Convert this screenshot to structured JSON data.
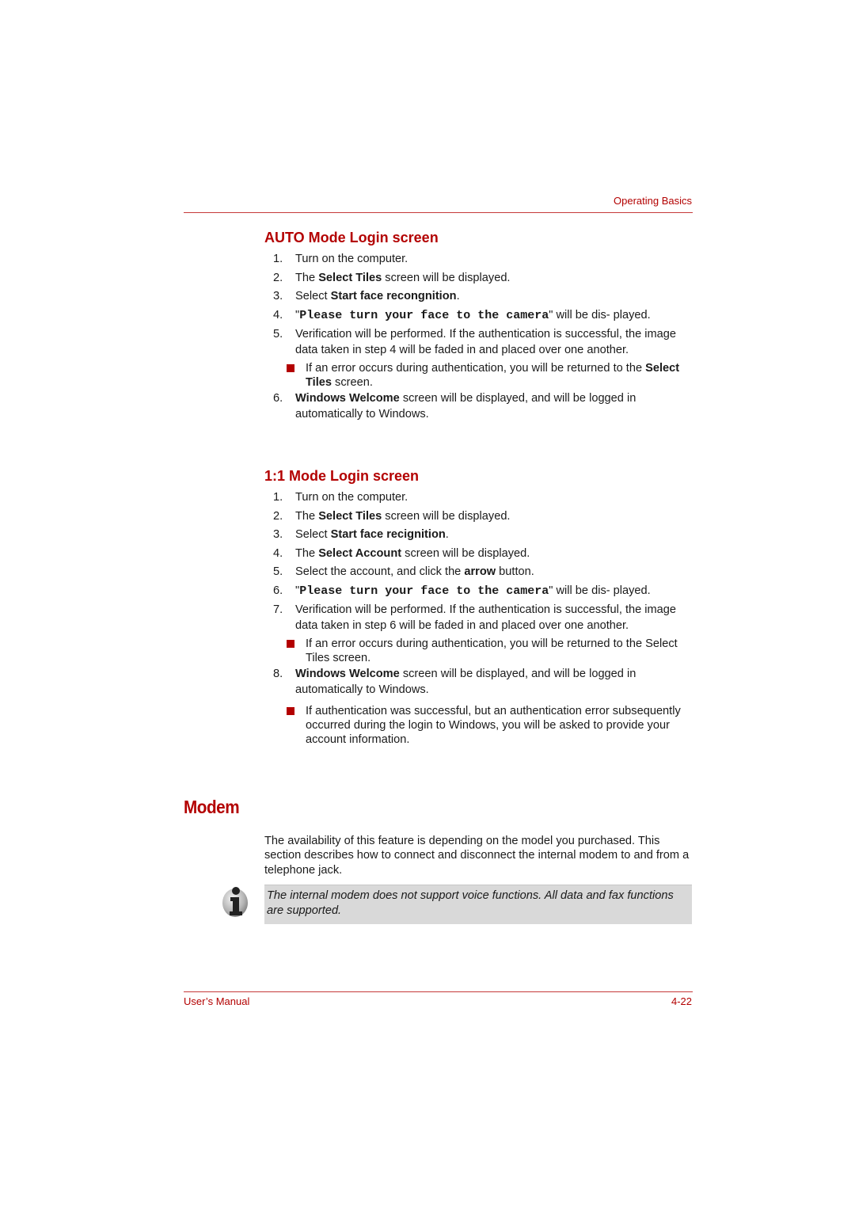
{
  "header": {
    "section_title": "Operating Basics"
  },
  "auto_mode": {
    "heading": "AUTO Mode Login screen",
    "steps": [
      {
        "num": "1.",
        "parts": [
          {
            "t": "Turn on the computer."
          }
        ]
      },
      {
        "num": "2.",
        "parts": [
          {
            "t": "The "
          },
          {
            "b": "Select Tiles"
          },
          {
            "t": " screen will be displayed."
          }
        ]
      },
      {
        "num": "3.",
        "parts": [
          {
            "t": "Select "
          },
          {
            "b": "Start face recongnition"
          },
          {
            "t": "."
          }
        ]
      },
      {
        "num": "4.",
        "parts": [
          {
            "t": "\""
          },
          {
            "m": "Please turn your face to the camera"
          },
          {
            "t": "\" will be dis- played."
          }
        ]
      },
      {
        "num": "5.",
        "parts": [
          {
            "t": "Verification will be performed. If the authentication is successful, the image data taken in step 4 will be faded in and placed over one another."
          }
        ]
      }
    ],
    "note": [
      {
        "t": "If an error occurs during authentication, you will be returned to the "
      },
      {
        "b": "Select Tiles"
      },
      {
        "t": " screen."
      }
    ],
    "steps_after": [
      {
        "num": "6.",
        "parts": [
          {
            "b": "Windows Welcome"
          },
          {
            "t": " screen will be displayed, and will be logged in automatically to Windows."
          }
        ]
      }
    ]
  },
  "one_to_one_mode": {
    "heading": "1:1 Mode Login screen",
    "steps": [
      {
        "num": "1.",
        "parts": [
          {
            "t": "Turn on the computer."
          }
        ]
      },
      {
        "num": "2.",
        "parts": [
          {
            "t": "The "
          },
          {
            "b": "Select Tiles"
          },
          {
            "t": " screen will be displayed."
          }
        ]
      },
      {
        "num": "3.",
        "parts": [
          {
            "t": "Select "
          },
          {
            "b": "Start face recignition"
          },
          {
            "t": "."
          }
        ]
      },
      {
        "num": "4.",
        "parts": [
          {
            "t": "The "
          },
          {
            "b": "Select Account"
          },
          {
            "t": " screen will be displayed."
          }
        ]
      },
      {
        "num": "5.",
        "parts": [
          {
            "t": "Select the account, and click the "
          },
          {
            "b": "arrow"
          },
          {
            "t": " button."
          }
        ]
      },
      {
        "num": "6.",
        "parts": [
          {
            "t": "\""
          },
          {
            "m": "Please turn your face to the camera"
          },
          {
            "t": "\" will be dis- played."
          }
        ]
      },
      {
        "num": "7.",
        "parts": [
          {
            "t": "Verification will be performed. If the authentication is successful, the image data taken in step 6 will be faded in and placed over one another."
          }
        ]
      }
    ],
    "note": [
      {
        "t": "If an error occurs during authentication, you will be returned to the Select Tiles screen."
      }
    ],
    "steps_after": [
      {
        "num": "8.",
        "parts": [
          {
            "b": "Windows Welcome"
          },
          {
            "t": " screen will be displayed, and will be logged in automatically to Windows."
          }
        ]
      }
    ],
    "note_after": [
      {
        "t": "If authentication was successful, but an authentication error subsequently occurred during the login to Windows, you will be asked to provide your account information."
      }
    ]
  },
  "modem": {
    "title": "Modem",
    "paragraph": "The availability of this feature is depending on the model you purchased. This section describes how to connect and disconnect the internal modem to and from a telephone jack.",
    "note": "The internal modem does not support voice functions. All data and fax functions are supported.",
    "note_icon": "info-icon"
  },
  "footer": {
    "left": "User’s Manual",
    "right": "4-22"
  },
  "colors": {
    "accent": "#b30000",
    "note_bg": "#d9d9d9"
  }
}
